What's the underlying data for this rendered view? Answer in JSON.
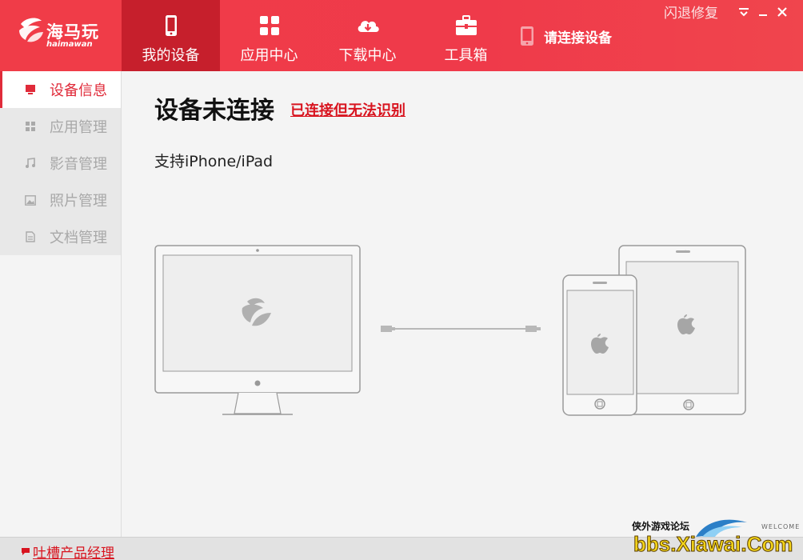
{
  "brand": {
    "name": "海马玩",
    "sub": "haimawan"
  },
  "nav": [
    {
      "label": "我的设备",
      "icon": "phone-icon",
      "active": true
    },
    {
      "label": "应用中心",
      "icon": "grid-icon",
      "active": false
    },
    {
      "label": "下载中心",
      "icon": "cloud-download-icon",
      "active": false
    },
    {
      "label": "工具箱",
      "icon": "toolbox-icon",
      "active": false
    }
  ],
  "device_status": "请连接设备",
  "window": {
    "repair": "闪退修复",
    "menu": "▼",
    "minimize": "—",
    "close": "✕"
  },
  "sidebar": [
    {
      "label": "设备信息",
      "icon": "monitor-icon",
      "active": true
    },
    {
      "label": "应用管理",
      "icon": "apps-icon",
      "active": false
    },
    {
      "label": "影音管理",
      "icon": "music-icon",
      "active": false
    },
    {
      "label": "照片管理",
      "icon": "photo-icon",
      "active": false
    },
    {
      "label": "文档管理",
      "icon": "document-icon",
      "active": false
    }
  ],
  "main": {
    "title": "设备未连接",
    "link": "已连接但无法识别",
    "support": "支持iPhone/iPad"
  },
  "footer": {
    "feedback": "吐槽产品经理"
  },
  "watermark": {
    "top": "侠外游戏论坛",
    "welcome": "WELCOME",
    "main": "bbs.Xiawai.Com"
  },
  "colors": {
    "brand_red": "#ef3a4a",
    "active_nav": "#c61f2c",
    "link_red": "#d8141f"
  }
}
